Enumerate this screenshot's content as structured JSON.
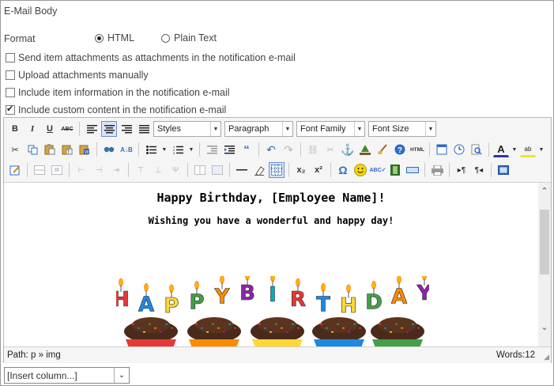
{
  "section_title": "E-Mail Body",
  "format": {
    "label": "Format",
    "options": [
      {
        "label": "HTML",
        "selected": true
      },
      {
        "label": "Plain Text",
        "selected": false
      }
    ]
  },
  "checkboxes": [
    {
      "label": "Send item attachments as attachments in the notification e-mail",
      "checked": false
    },
    {
      "label": "Upload attachments manually",
      "checked": false
    },
    {
      "label": "Include item information in the notification e-mail",
      "checked": false
    },
    {
      "label": "Include custom content in the notification e-mail",
      "checked": true
    }
  ],
  "toolbar": {
    "styles": "Styles",
    "paragraph": "Paragraph",
    "font_family": "Font Family",
    "font_size": "Font Size",
    "bold": "B",
    "italic": "I",
    "underline": "U",
    "strike": "ABC",
    "html": "HTML",
    "subscript": "x₂",
    "superscript": "x²",
    "omega": "Ω"
  },
  "content": {
    "heading": "Happy Birthday, [Employee Name]!",
    "subheading": "Wishing you have a wonderful and happy day!",
    "banner_letters": [
      "H",
      "A",
      "P",
      "P",
      "Y",
      "B",
      "I",
      "R",
      "T",
      "H",
      "D",
      "A",
      "Y"
    ],
    "banner_colors": [
      "#e53935",
      "#1e88e5",
      "#fdd835",
      "#43a047",
      "#fb8c00",
      "#8e24aa",
      "#00acc1"
    ]
  },
  "status": {
    "path": "Path: p » img",
    "words": "Words:12"
  },
  "insert_column": "[Insert column...]"
}
